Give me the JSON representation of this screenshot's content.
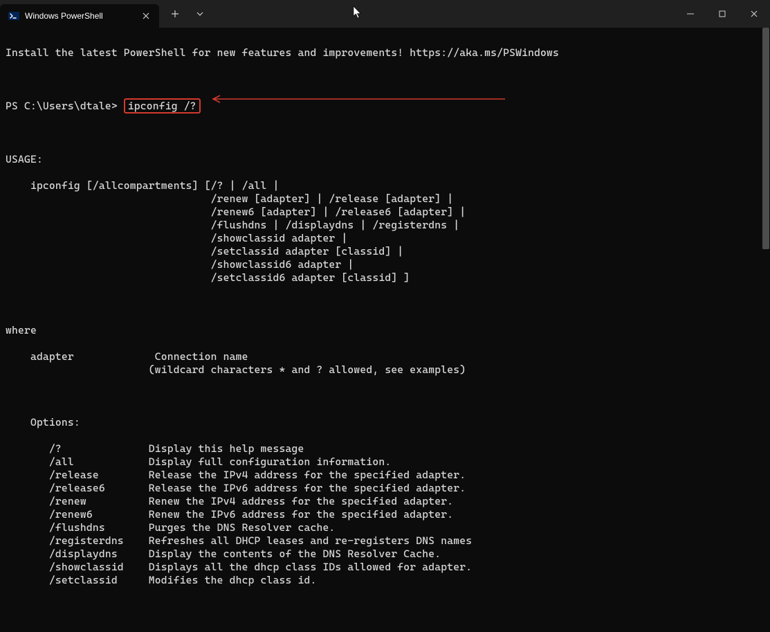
{
  "tab": {
    "title": "Windows PowerShell"
  },
  "terminal": {
    "banner": "Install the latest PowerShell for new features and improvements! https://aka.ms/PSWindows",
    "prompt": "PS C:\\Users\\dtale> ",
    "command": "ipconfig /?",
    "usage_header": "USAGE:",
    "usage_lines": [
      "    ipconfig [/allcompartments] [/? | /all |",
      "                                 /renew [adapter] | /release [adapter] |",
      "                                 /renew6 [adapter] | /release6 [adapter] |",
      "                                 /flushdns | /displaydns | /registerdns |",
      "                                 /showclassid adapter |",
      "                                 /setclassid adapter [classid] |",
      "                                 /showclassid6 adapter |",
      "                                 /setclassid6 adapter [classid] ]"
    ],
    "where_header": "where",
    "where_lines": [
      "    adapter             Connection name",
      "                       (wildcard characters * and ? allowed, see examples)"
    ],
    "options_header": "    Options:",
    "options": [
      {
        "flag": "       /?           ",
        "desc": "Display this help message"
      },
      {
        "flag": "       /all         ",
        "desc": "Display full configuration information."
      },
      {
        "flag": "       /release     ",
        "desc": "Release the IPv4 address for the specified adapter."
      },
      {
        "flag": "       /release6    ",
        "desc": "Release the IPv6 address for the specified adapter."
      },
      {
        "flag": "       /renew       ",
        "desc": "Renew the IPv4 address for the specified adapter."
      },
      {
        "flag": "       /renew6      ",
        "desc": "Renew the IPv6 address for the specified adapter."
      },
      {
        "flag": "       /flushdns    ",
        "desc": "Purges the DNS Resolver cache."
      },
      {
        "flag": "       /registerdns ",
        "desc": "Refreshes all DHCP leases and re-registers DNS names"
      },
      {
        "flag": "       /displaydns  ",
        "desc": "Display the contents of the DNS Resolver Cache."
      },
      {
        "flag": "       /showclassid ",
        "desc": "Displays all the dhcp class IDs allowed for adapter."
      },
      {
        "flag": "       /setclassid  ",
        "desc": "Modifies the dhcp class id."
      }
    ]
  }
}
